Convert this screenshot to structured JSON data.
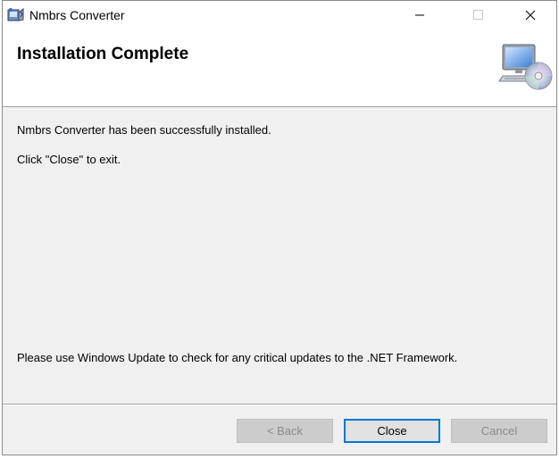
{
  "window": {
    "title": "Nmbrs Converter",
    "app_icon": "installer-icon",
    "controls": {
      "minimize_icon": "minimize-icon",
      "maximize_icon": "maximize-icon",
      "close_icon": "close-icon"
    }
  },
  "header": {
    "title": "Installation Complete",
    "icon": "computer-cd-icon"
  },
  "body": {
    "success_message": "Nmbrs Converter has been successfully installed.",
    "exit_instruction": "Click \"Close\" to exit.",
    "update_notice": "Please use Windows Update to check for any critical updates to the .NET Framework."
  },
  "buttons": {
    "back_label": "< Back",
    "close_label": "Close",
    "cancel_label": "Cancel"
  },
  "colors": {
    "focus_border": "#0078d7",
    "dialog_background": "#f0f0f0",
    "disabled_text": "#8a8a8a"
  }
}
